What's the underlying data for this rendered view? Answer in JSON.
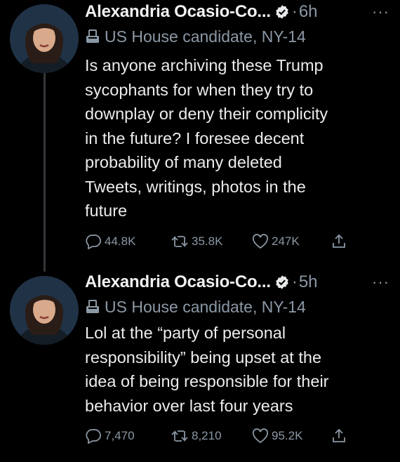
{
  "tweets": [
    {
      "name": "Alexandria Ocasio-Co...",
      "time": "6h",
      "label": "US House candidate, NY-14",
      "text": "Is anyone archiving these Trump\nsycophants for when they try to\ndownplay or deny their complicity\nin the future? I foresee decent\nprobability of many deleted\nTweets, writings, photos in the\nfuture",
      "replies": "44.8K",
      "retweets": "35.8K",
      "likes": "247K"
    },
    {
      "name": "Alexandria Ocasio-Co...",
      "time": "5h",
      "label": "US House candidate, NY-14",
      "text": "Lol at the “party of personal\nresponsibility” being upset at the\nidea of being responsible for their\nbehavior over last four years",
      "replies": "7,470",
      "retweets": "8,210",
      "likes": "95.2K"
    }
  ],
  "separator_dot": "·",
  "more_glyph": "···",
  "colors": {
    "background": "#000000",
    "text": "#e7e9ea",
    "secondary": "#8b98a5",
    "thread_line": "#333639"
  },
  "icons": [
    "verified-badge-icon",
    "ballot-box-icon",
    "reply-icon",
    "retweet-icon",
    "like-icon",
    "share-icon",
    "more-icon"
  ]
}
